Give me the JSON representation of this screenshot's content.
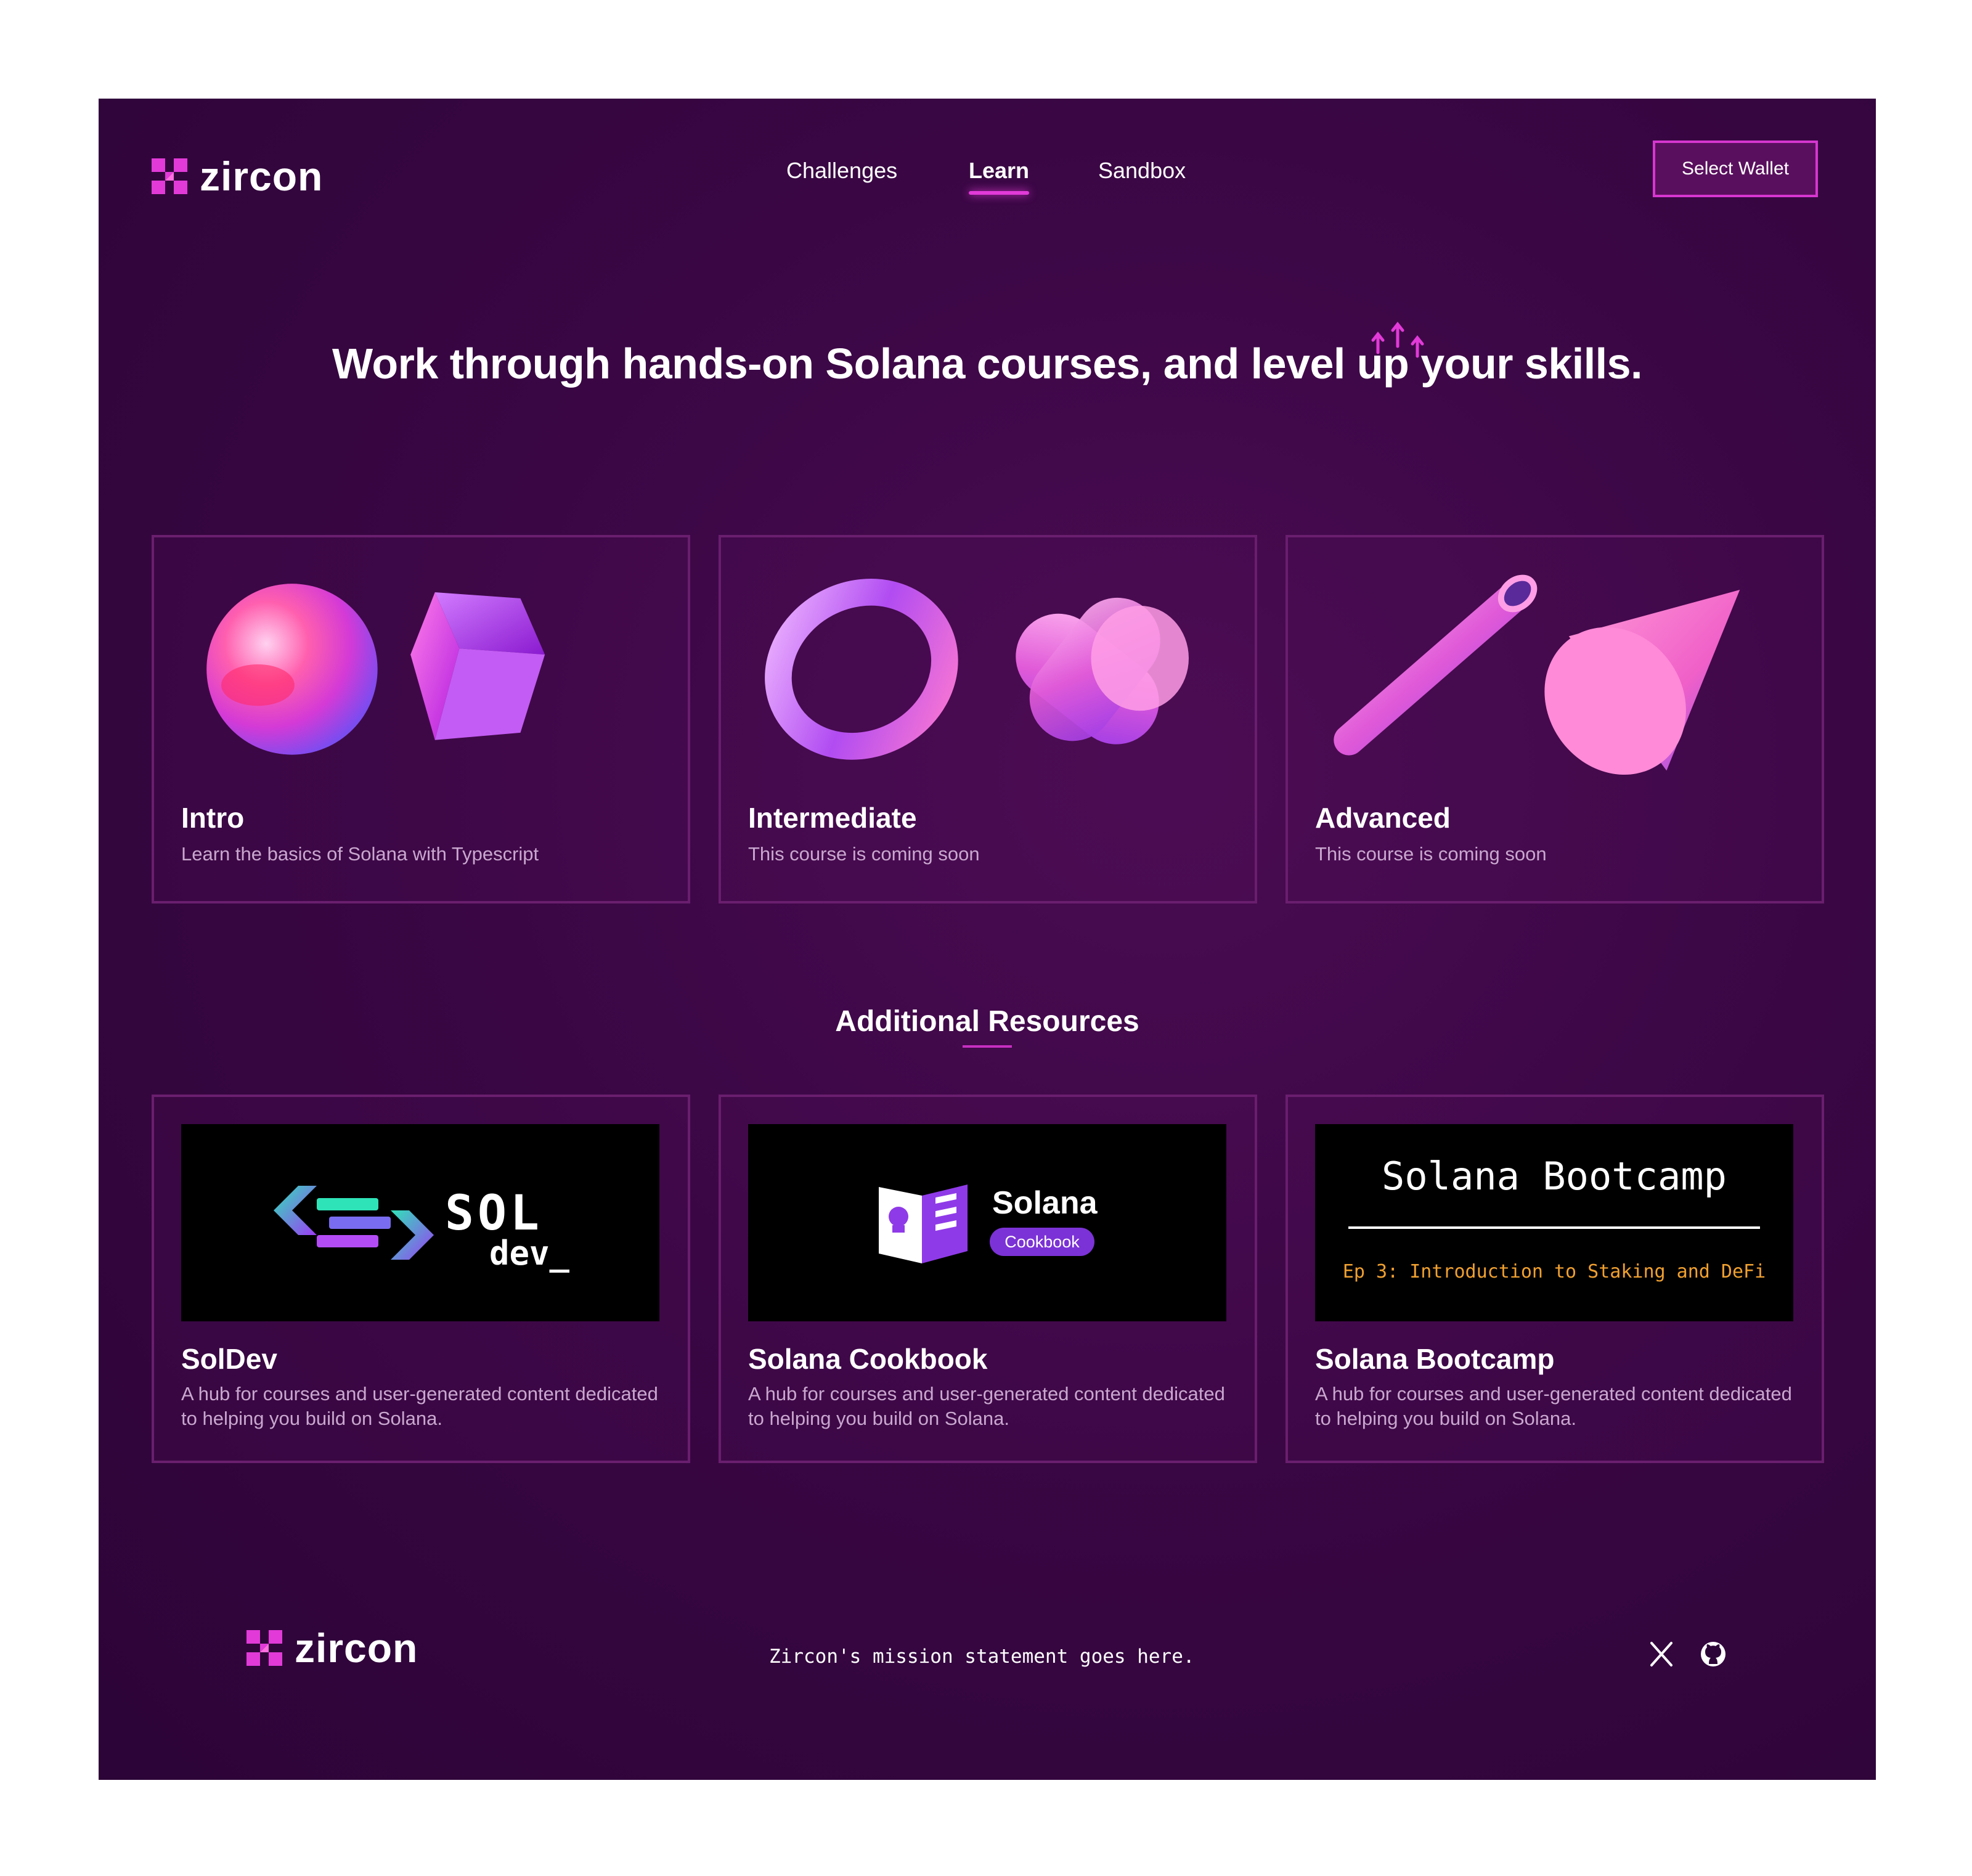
{
  "brand": {
    "name": "zircon"
  },
  "nav": {
    "items": [
      {
        "label": "Challenges",
        "active": false
      },
      {
        "label": "Learn",
        "active": true
      },
      {
        "label": "Sandbox",
        "active": false
      }
    ],
    "wallet_button": "Select Wallet"
  },
  "hero": {
    "title": "Work through hands-on Solana courses, and level up your skills."
  },
  "courses": [
    {
      "title": "Intro",
      "description": "Learn the basics of Solana with Typescript"
    },
    {
      "title": "Intermediate",
      "description": "This course is coming soon"
    },
    {
      "title": "Advanced",
      "description": "This course is coming soon"
    }
  ],
  "resources_heading": "Additional Resources",
  "resources": [
    {
      "title": "SolDev",
      "description": "A hub for courses and user-generated content dedicated to helping you build on Solana.",
      "banner": {
        "line1": "SOL",
        "line2": "dev_"
      }
    },
    {
      "title": "Solana Cookbook",
      "description": "A hub for courses and user-generated content dedicated to helping you build on Solana.",
      "banner": {
        "line1": "Solana",
        "badge": "Cookbook"
      }
    },
    {
      "title": "Solana Bootcamp",
      "description": "A hub for courses and user-generated content dedicated to helping you build on Solana.",
      "banner": {
        "line1": "Solana Bootcamp",
        "line2": "Ep 3: Introduction to Staking and DeFi"
      }
    }
  ],
  "footer": {
    "mission": "Zircon's mission statement goes here.",
    "social_icons": [
      "x-icon",
      "github-icon"
    ]
  },
  "colors": {
    "accent": "#e23ad8",
    "background": "#3a0744",
    "card_border": "#6a1e6e",
    "muted_text": "#c9a7cf"
  }
}
